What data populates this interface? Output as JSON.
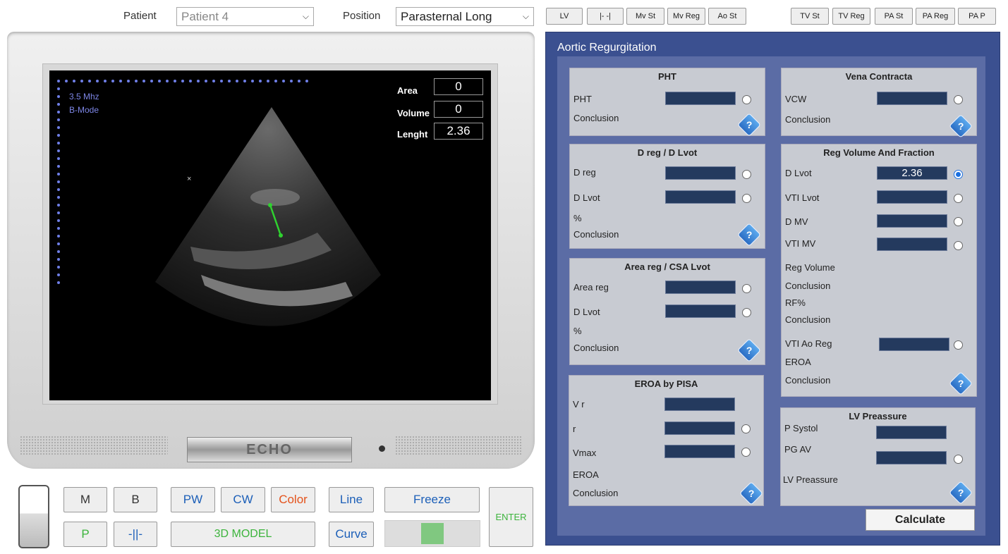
{
  "header": {
    "patient_label": "Patient",
    "patient_value": "Patient 4",
    "position_label": "Position",
    "position_value": "Parasternal Long",
    "views_left": [
      "LV",
      "|- -|",
      "Mv St",
      "Mv Reg",
      "Ao St"
    ],
    "views_right": [
      "TV St",
      "TV Reg",
      "PA St",
      "PA Reg",
      "PA P"
    ]
  },
  "screen": {
    "freq": "3.5 Mhz",
    "mode": "B-Mode",
    "area_label": "Area",
    "area_value": "0",
    "volume_label": "Volume",
    "volume_value": "0",
    "length_label": "Lenght",
    "length_value": "2.36",
    "marker": "×"
  },
  "device": {
    "logo": "ECHO"
  },
  "controls": {
    "m": "M",
    "b": "B",
    "pw": "PW",
    "cw": "CW",
    "color": "Color",
    "line": "Line",
    "freeze": "Freeze",
    "p": "P",
    "split": "-||-",
    "model3d": "3D MODEL",
    "curve": "Curve",
    "enter": "ENTER"
  },
  "panel": {
    "title": "Aortic Regurgitation",
    "calculate": "Calculate",
    "pht": {
      "title": "PHT",
      "pht": "PHT",
      "conclusion": "Conclusion"
    },
    "dreg": {
      "title": "D reg / D Lvot",
      "dreg": "D reg",
      "dlvot": "D Lvot",
      "pct": "%",
      "conclusion": "Conclusion"
    },
    "areareg": {
      "title": "Area reg / CSA Lvot",
      "areareg": "Area reg",
      "dlvot": "D Lvot",
      "pct": "%",
      "conclusion": "Conclusion"
    },
    "eroa": {
      "title": "EROA by PISA",
      "vr": "V r",
      "r": "r",
      "vmax": "Vmax",
      "eroa": "EROA",
      "conclusion": "Conclusion"
    },
    "vena": {
      "title": "Vena Contracta",
      "vcw": "VCW",
      "conclusion": "Conclusion"
    },
    "regvol": {
      "title": "Reg Volume And Fraction",
      "dlvot": "D Lvot",
      "dlvot_value": "2.36",
      "vtilvot": "VTI Lvot",
      "dmv": "D MV",
      "vtimv": "VTI MV",
      "regvolume": "Reg Volume",
      "conclusion1": "Conclusion",
      "rf": "RF%",
      "conclusion2": "Conclusion",
      "vtiaoreg": "VTI Ao Reg",
      "eroa": "EROA",
      "conclusion3": "Conclusion"
    },
    "lvp": {
      "title": "LV Preassure",
      "psystol": "P Systol",
      "pgav": "PG AV",
      "lvp": "LV Preassure"
    }
  },
  "help_glyph": "?"
}
